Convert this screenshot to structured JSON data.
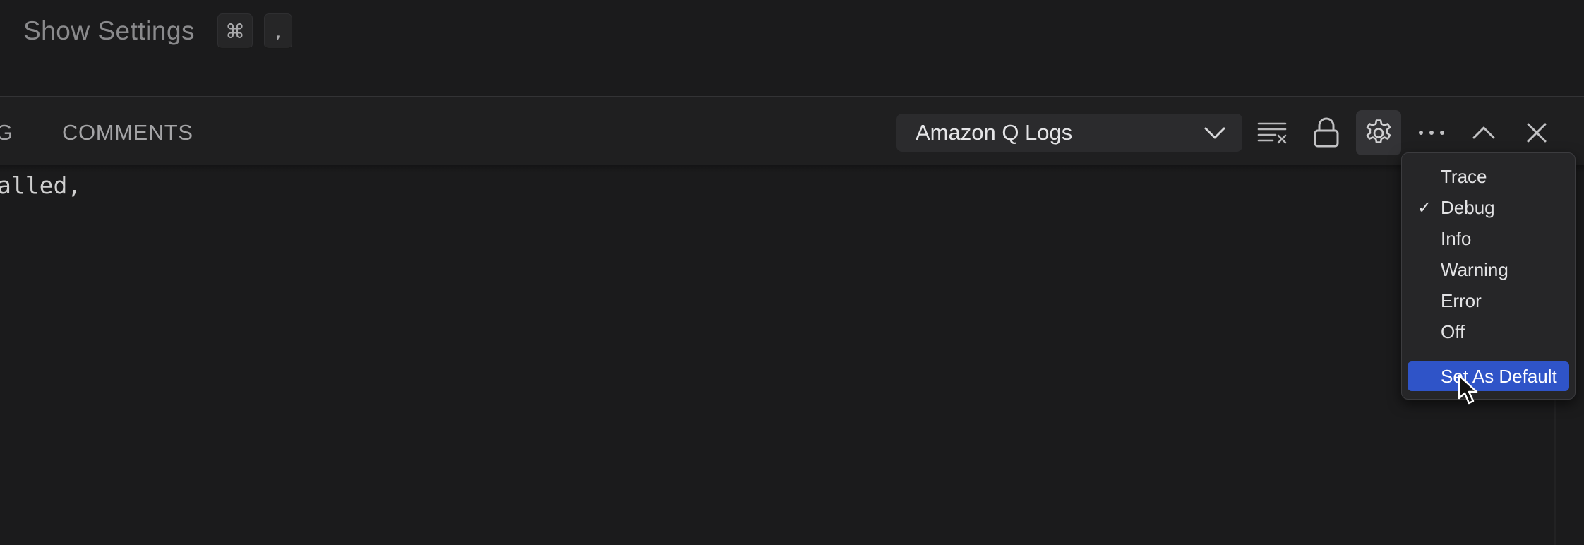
{
  "hint": {
    "label": "Show Settings",
    "keys": [
      "⌘",
      ","
    ]
  },
  "panel": {
    "tabs": [
      "G",
      "COMMENTS"
    ],
    "output_channel": "Amazon Q Logs",
    "toolbar_icons": [
      "clear-output-icon",
      "lock-scroll-icon",
      "gear-icon",
      "more-actions-icon",
      "maximize-panel-icon",
      "close-icon"
    ]
  },
  "output": {
    "lines": [
      "alled,"
    ]
  },
  "log_level_menu": {
    "items": [
      {
        "label": "Trace",
        "checked": false
      },
      {
        "label": "Debug",
        "checked": true
      },
      {
        "label": "Info",
        "checked": false
      },
      {
        "label": "Warning",
        "checked": false
      },
      {
        "label": "Error",
        "checked": false
      },
      {
        "label": "Off",
        "checked": false
      }
    ],
    "default_action": "Set As Default",
    "check_glyph": "✓"
  },
  "colors": {
    "background": "#1b1b1c",
    "menu_highlight": "#2f54c8"
  }
}
